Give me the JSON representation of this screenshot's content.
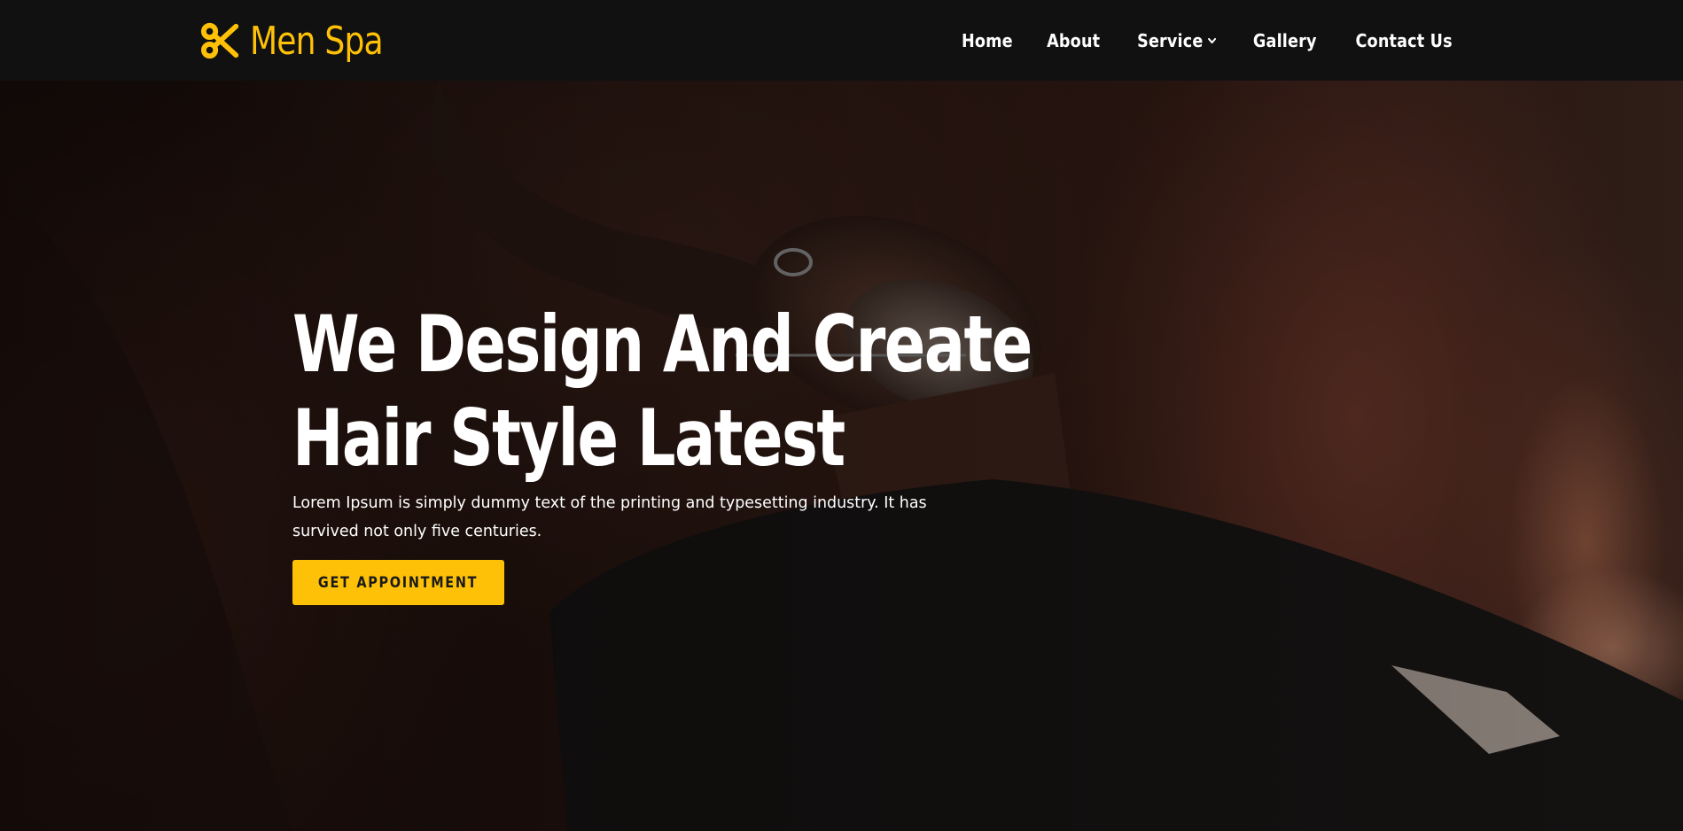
{
  "brand": {
    "name": "Men Spa",
    "icon": "scissors-icon",
    "accent_color": "#fec107"
  },
  "nav": {
    "items": [
      {
        "label": "Home"
      },
      {
        "label": "About"
      },
      {
        "label": "Service",
        "has_dropdown": true,
        "icon": "chevron-down-icon"
      },
      {
        "label": "Gallery"
      },
      {
        "label": "Contact Us"
      }
    ]
  },
  "hero": {
    "title_line1": "We Design And Create",
    "title_line2": "Hair Style Latest",
    "description": "Lorem Ipsum is simply dummy text of the printing and typesetting industry. It has survived not only five centuries.",
    "cta_label": "GET APPOINTMENT",
    "background": "barber-shaving-beard-photo"
  }
}
